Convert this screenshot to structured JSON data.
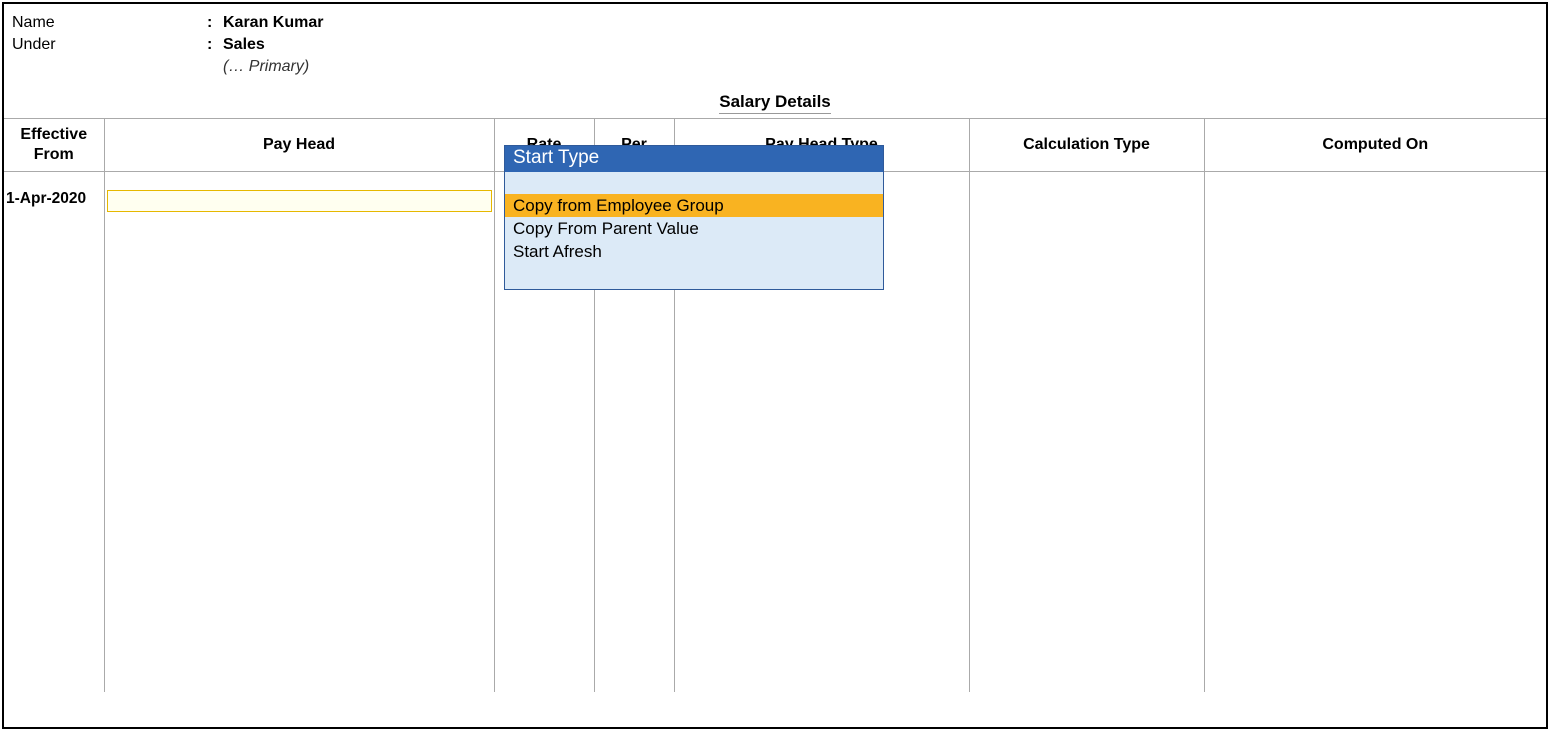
{
  "header": {
    "name_label": "Name",
    "name_value": "Karan Kumar",
    "under_label": "Under",
    "under_value": "Sales",
    "under_hierarchy": "(…  Primary)",
    "colon": ":"
  },
  "section_title": "Salary Details",
  "columns": {
    "effective_from": "Effective From",
    "pay_head": "Pay Head",
    "rate": "Rate",
    "per": "Per",
    "pay_head_type": "Pay Head Type",
    "calculation_type": "Calculation Type",
    "computed_on": "Computed On"
  },
  "row": {
    "effective_from": "1-Apr-2020",
    "pay_head_value": ""
  },
  "popup": {
    "title": "Start Type",
    "items": [
      {
        "label": "Copy from Employee Group",
        "selected": true
      },
      {
        "label": "Copy From Parent Value",
        "selected": false
      },
      {
        "label": "Start Afresh",
        "selected": false
      }
    ]
  }
}
